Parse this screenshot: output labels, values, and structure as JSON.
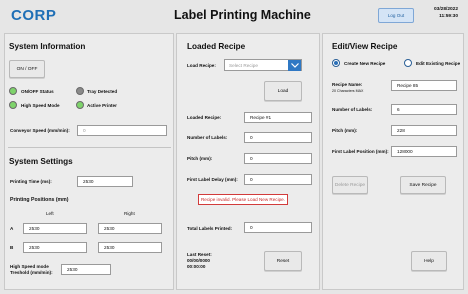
{
  "header": {
    "logo": "CORP",
    "title": "Label Printing Machine",
    "logout": "Log Out",
    "date": "03/28/2022",
    "time": "11:59:30"
  },
  "system_info": {
    "title": "System Information",
    "onoff": "ON / OFF",
    "indicators": {
      "onoff_status": {
        "label": "ON/OFF Status",
        "color": "#7ed36b"
      },
      "tray_detected": {
        "label": "Tray Detected",
        "color": "#8a8a8a"
      },
      "high_speed": {
        "label": "High Speed Mode",
        "color": "#7ed36b"
      },
      "active_printer": {
        "label": "Active Printer",
        "color": "#7ed36b"
      }
    },
    "conveyor_label": "Conveyor Speed (mm/min):",
    "conveyor_value": "0"
  },
  "system_settings": {
    "title": "System Settings",
    "printing_time_label": "Printing Time (ms):",
    "printing_time_value": "2530",
    "printing_positions_label": "Printing Positions (mm)",
    "left_label": "Left",
    "right_label": "Right",
    "row_a_label": "A",
    "row_b_label": "B",
    "a_left": "2530",
    "a_right": "2530",
    "b_left": "2530",
    "b_right": "2530",
    "hs_threshold_label_1": "High Speed mode",
    "hs_threshold_label_2": "Treshold (mm/min):",
    "hs_threshold_value": "2530"
  },
  "loaded_recipe": {
    "title": "Loaded Recipe",
    "load_recipe_label": "Load Recipe:",
    "select_placeholder": "Select Recipe",
    "load_button": "Load",
    "loaded_recipe_label": "Loaded Recipe:",
    "loaded_recipe_value": "Recipe #1",
    "num_labels_label": "Number of Labels:",
    "num_labels_value": "0",
    "pitch_label": "Pitch (mm):",
    "pitch_value": "0",
    "first_label_delay_label": "First Label Delay (mm):",
    "first_label_delay_value": "0",
    "error_message": "Recipe invalid. Please Load New Recipe.",
    "total_labels_label": "Total Labels Printed:",
    "total_labels_value": "0",
    "last_reset_label": "Last Reset:",
    "last_reset_date": "00/00/0000",
    "last_reset_time": "00:00:00",
    "reset_button": "Reset"
  },
  "edit_recipe": {
    "title": "Edit/View Recipe",
    "create_new": "Create New Recipe",
    "edit_existing": "Edit Existing Recipe",
    "recipe_name_label": "Recipe Name:",
    "recipe_name_hint": "20 Characters MAX",
    "recipe_name_value": "Recipe 85",
    "num_labels_label": "Number of Labels:",
    "num_labels_value": "6",
    "pitch_label": "Pitch (mm):",
    "pitch_value": "228",
    "first_label_label": "First Label Position (mm):",
    "first_label_value": "128000",
    "delete_button": "Delete Recipe",
    "save_button": "Save Recipe",
    "help_button": "Help"
  }
}
